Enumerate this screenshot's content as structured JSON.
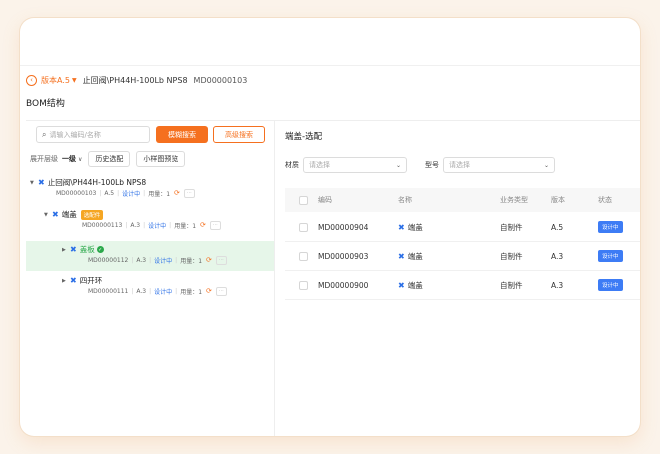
{
  "header": {
    "version": "版本A.5",
    "product_name": "止回阀\\PH44H-100Lb NPS8",
    "product_code": "MD00000103"
  },
  "bom_title": "BOM结构",
  "search": {
    "placeholder": "请输入编码/名称",
    "fuzzy_label": "模糊搜索",
    "advanced_label": "高级搜索"
  },
  "tree_toolbar": {
    "expand_label": "展开层级",
    "level": "一级",
    "history_label": "历史选配",
    "preview_label": "小样图预览"
  },
  "tree": [
    {
      "name": "止回阀\\PH44H-100Lb NPS8",
      "tag": "",
      "code": "MD00000103",
      "version": "A.5",
      "status": "设计中",
      "qty": "用量：1"
    },
    {
      "name": "端盖",
      "tag": "选配件",
      "code": "MD00000113",
      "version": "A.3",
      "status": "设计中",
      "qty": "用量：1"
    },
    {
      "name": "盖板",
      "tag": "",
      "code": "MD00000112",
      "version": "A.3",
      "status": "设计中",
      "qty": "用量：1"
    },
    {
      "name": "四开环",
      "tag": "",
      "code": "MD00000111",
      "version": "A.3",
      "status": "设计中",
      "qty": "用量：1"
    }
  ],
  "panel_title": "端盖-选配",
  "filters": {
    "material_label": "材质",
    "material_placeholder": "请选择",
    "model_label": "型号",
    "model_placeholder": "请选择"
  },
  "table": {
    "columns": [
      "编码",
      "名称",
      "业务类型",
      "版本",
      "状态"
    ],
    "rows": [
      {
        "code": "MD00000904",
        "name": "端盖",
        "type": "自制件",
        "version": "A.5",
        "status": "设计中"
      },
      {
        "code": "MD00000903",
        "name": "端盖",
        "type": "自制件",
        "version": "A.3",
        "status": "设计中"
      },
      {
        "code": "MD00000900",
        "name": "端盖",
        "type": "自制件",
        "version": "A.3",
        "status": "设计中"
      }
    ]
  },
  "colors": {
    "accent": "#f5701f",
    "primary": "#3d7cf5",
    "selected_bg": "#e6f6e9"
  },
  "icons": {
    "back": "back-circle-icon",
    "part": "part-x-icon",
    "sync": "sync-icon",
    "more": "more-icon",
    "check": "check-circle-icon"
  }
}
